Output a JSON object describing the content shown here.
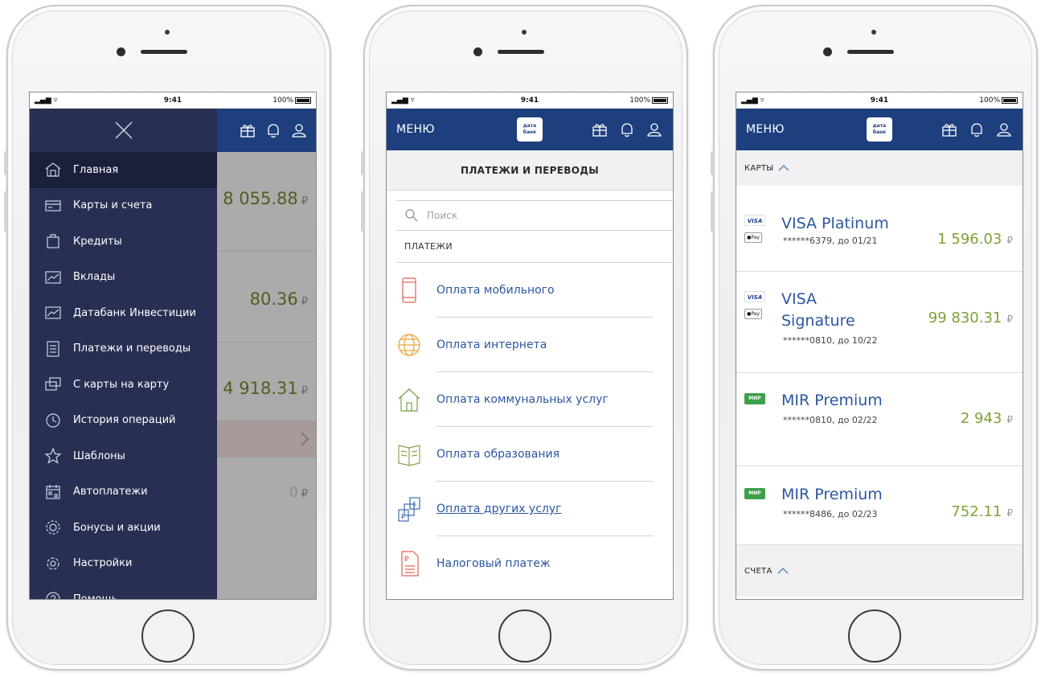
{
  "status_bar": {
    "signal": "▂▄▆ ▿",
    "time": "9:41",
    "battery": "100%"
  },
  "header": {
    "menu_label": "МЕНЮ",
    "logo_line1": "дата",
    "logo_line2": "банк"
  },
  "colors": {
    "header_blue": "#1e3f7d",
    "drawer": "#292f52",
    "link_blue": "#2c56a0",
    "amount_green": "#7ba335"
  },
  "menu": {
    "items": [
      {
        "label": "Главная",
        "icon": "home-icon"
      },
      {
        "label": "Карты и счета",
        "icon": "cards-icon"
      },
      {
        "label": "Кредиты",
        "icon": "credit-icon"
      },
      {
        "label": "Вклады",
        "icon": "deposit-chart-icon"
      },
      {
        "label": "Датабанк Инвестиции",
        "icon": "investment-chart-icon"
      },
      {
        "label": "Платежи и переводы",
        "icon": "payments-doc-icon"
      },
      {
        "label": "С карты на карту",
        "icon": "card-transfer-icon"
      },
      {
        "label": "История операций",
        "icon": "clock-icon"
      },
      {
        "label": "Шаблоны",
        "icon": "star-icon"
      },
      {
        "label": "Автоплатежи",
        "icon": "calendar-icon"
      },
      {
        "label": "Бонусы и акции",
        "icon": "bonus-gear-icon"
      },
      {
        "label": "Настройки",
        "icon": "settings-icon"
      },
      {
        "label": "Помощь",
        "icon": "help-icon"
      }
    ],
    "behind_amounts": [
      "8 055.88",
      "80.36",
      "4 918.31",
      "0"
    ],
    "currency": "₽"
  },
  "payments": {
    "title": "ПЛАТЕЖИ И ПЕРЕВОДЫ",
    "search_placeholder": "Поиск",
    "section": "ПЛАТЕЖИ",
    "items": [
      {
        "label": "Оплата мобильного",
        "icon": "mobile-phone-icon"
      },
      {
        "label": "Оплата интернета",
        "icon": "globe-icon"
      },
      {
        "label": "Оплата коммунальных услуг",
        "icon": "house-icon"
      },
      {
        "label": "Оплата образования",
        "icon": "book-icon"
      },
      {
        "label": "Оплата других услуг",
        "icon": "currency-docs-icon"
      },
      {
        "label": "Налоговый платеж",
        "icon": "tax-doc-icon"
      }
    ]
  },
  "accounts": {
    "cards_header": "КАРТЫ",
    "accounts_header": "СЧЕТА",
    "currency": "₽",
    "apple_pay": "●Pay",
    "cards": [
      {
        "brand": "VISA",
        "name": "VISA Platinum",
        "number": "******6379, до 01/21",
        "amount": "1 596.03",
        "apple_pay": true
      },
      {
        "brand": "VISA",
        "name": "VISA Signature",
        "name_line1": "VISA",
        "name_line2": "Signature",
        "number": "******0810, до 10/22",
        "amount": "99 830.31",
        "apple_pay": true
      },
      {
        "brand": "МИР",
        "name": "MIR Premium",
        "number": "******0810, до 02/22",
        "amount": "2 943",
        "apple_pay": false
      },
      {
        "brand": "МИР",
        "name": "MIR Premium",
        "number": "******8486, до 02/23",
        "amount": "752.11",
        "apple_pay": false
      }
    ]
  }
}
